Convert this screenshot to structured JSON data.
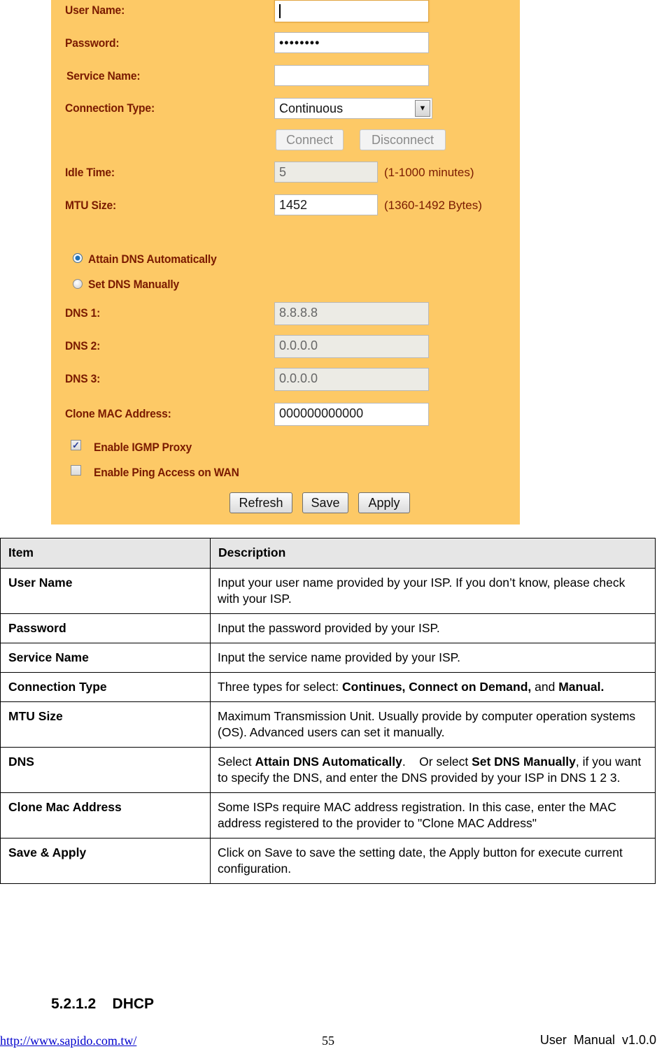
{
  "form": {
    "user_name": {
      "label": "User Name:",
      "value": ""
    },
    "password": {
      "label": "Password:",
      "value": "••••••••"
    },
    "service_name": {
      "label": "Service Name:",
      "value": ""
    },
    "connection_type": {
      "label": "Connection Type:",
      "selected": "Continuous"
    },
    "connect_button": "Connect",
    "disconnect_button": "Disconnect",
    "idle_time": {
      "label": "Idle Time:",
      "value": "5",
      "hint": "(1-1000 minutes)"
    },
    "mtu_size": {
      "label": "MTU Size:",
      "value": "1452",
      "hint": "(1360-1492 Bytes)"
    },
    "dns_mode": {
      "options": [
        {
          "label": "Attain DNS Automatically",
          "selected": true
        },
        {
          "label": "Set DNS Manually",
          "selected": false
        }
      ]
    },
    "dns1": {
      "label": "DNS 1:",
      "value": "8.8.8.8"
    },
    "dns2": {
      "label": "DNS 2:",
      "value": "0.0.0.0"
    },
    "dns3": {
      "label": "DNS 3:",
      "value": "0.0.0.0"
    },
    "clone_mac": {
      "label": "Clone MAC Address:",
      "value": "000000000000"
    },
    "igmp_proxy": {
      "label": "Enable IGMP Proxy",
      "checked": true
    },
    "ping_wan": {
      "label": "Enable Ping Access on WAN",
      "checked": false
    },
    "buttons": {
      "refresh": "Refresh",
      "save": "Save",
      "apply": "Apply"
    },
    "colors": {
      "panel_bg": "#fdc966",
      "label_text": "#7a1a00"
    }
  },
  "table": {
    "headers": {
      "item": "Item",
      "description": "Description"
    },
    "rows": [
      {
        "item": "User Name",
        "desc": [
          "Input your user name provided by your ISP.    If you don’t know, please check with your ISP."
        ]
      },
      {
        "item": "Password",
        "desc": [
          "Input the password provided by your ISP."
        ]
      },
      {
        "item": "Service Name",
        "desc": [
          "Input the service name provided by your ISP."
        ]
      },
      {
        "item": "Connection Type",
        "desc": [
          "Three types for select: ",
          "Continues, Connect on Demand,",
          " and ",
          "Manual."
        ]
      },
      {
        "item": "MTU Size",
        "desc": [
          "Maximum Transmission Unit. Usually provide by computer operation systems (OS). Advanced users can set it manually."
        ]
      },
      {
        "item": "DNS",
        "desc": [
          "Select ",
          "Attain DNS Automatically",
          ".    Or select ",
          "Set DNS Manually",
          ", if you want to specify the DNS, and enter the DNS provided by your ISP in DNS 1 2 3."
        ]
      },
      {
        "item": "Clone Mac Address",
        "desc": [
          "Some ISPs require MAC address registration. In this case, enter the MAC address registered to the provider to \"Clone MAC Address\""
        ]
      },
      {
        "item": "Save & Apply",
        "desc": [
          "Click on Save to save the setting date, the Apply button for execute current configuration."
        ]
      }
    ]
  },
  "section_heading": "5.2.1.2    DHCP",
  "footer": {
    "link": "http://www.sapido.com.tw/",
    "page_number": "55",
    "manual_version": "User  Manual  v1.0.0"
  }
}
